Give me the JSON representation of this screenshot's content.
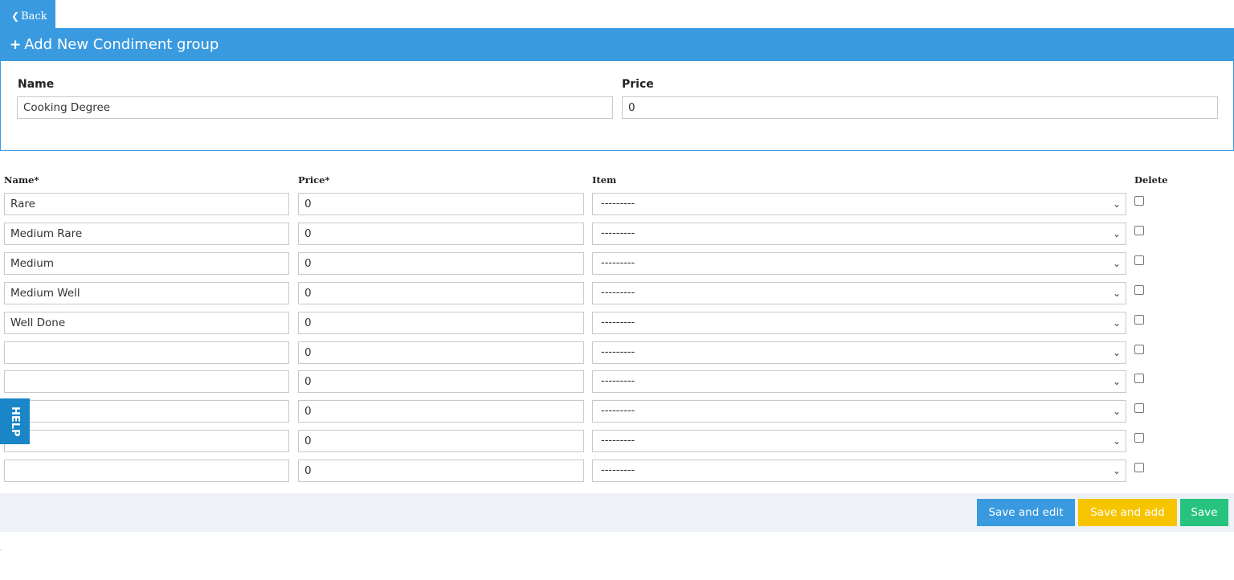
{
  "back": {
    "label": "Back",
    "icon": "chevron-left-icon"
  },
  "panel": {
    "title": "Add New Condiment group",
    "icon": "plus-icon",
    "name_label": "Name",
    "name_value": "Cooking Degree",
    "price_label": "Price",
    "price_value": "0"
  },
  "columns": {
    "name": "Name*",
    "price": "Price*",
    "item": "Item",
    "delete": "Delete"
  },
  "rows": [
    {
      "name": "Rare",
      "price": "0",
      "item": "---------"
    },
    {
      "name": "Medium Rare",
      "price": "0",
      "item": "---------"
    },
    {
      "name": "Medium",
      "price": "0",
      "item": "---------"
    },
    {
      "name": "Medium Well",
      "price": "0",
      "item": "---------"
    },
    {
      "name": "Well Done",
      "price": "0",
      "item": "---------"
    },
    {
      "name": "",
      "price": "0",
      "item": "---------"
    },
    {
      "name": "",
      "price": "0",
      "item": "---------"
    },
    {
      "name": "",
      "price": "0",
      "item": "---------"
    },
    {
      "name": "",
      "price": "0",
      "item": "---------"
    },
    {
      "name": "",
      "price": "0",
      "item": "---------"
    }
  ],
  "help": {
    "label": "HELP"
  },
  "actions": {
    "save_and_edit": "Save and edit",
    "save_and_add": "Save and add",
    "save": "Save"
  },
  "colors": {
    "primary": "#3a9ae0",
    "help": "#1a86c8",
    "warning": "#f6c500",
    "success": "#28c27f",
    "footer_bg": "#eef1f6"
  }
}
